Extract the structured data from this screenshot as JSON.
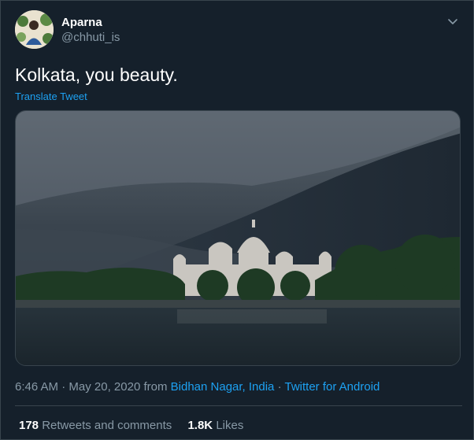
{
  "user": {
    "display_name": "Aparna",
    "handle": "@chhuti_is"
  },
  "tweet": {
    "text": "Kolkata, you beauty.",
    "translate_label": "Translate Tweet"
  },
  "meta": {
    "time": "6:46 AM",
    "date": "May 20, 2020",
    "from_word": "from",
    "location": "Bidhan Nagar, India",
    "source": "Twitter for Android",
    "separator": "·"
  },
  "stats": {
    "retweets_count": "178",
    "retweets_label": "Retweets and comments",
    "likes_count": "1.8K",
    "likes_label": "Likes"
  },
  "icons": {
    "menu": "chevron-down-icon"
  },
  "colors": {
    "background": "#15202b",
    "border": "#38444d",
    "secondary_text": "#8899a6",
    "link": "#1da1f2"
  }
}
